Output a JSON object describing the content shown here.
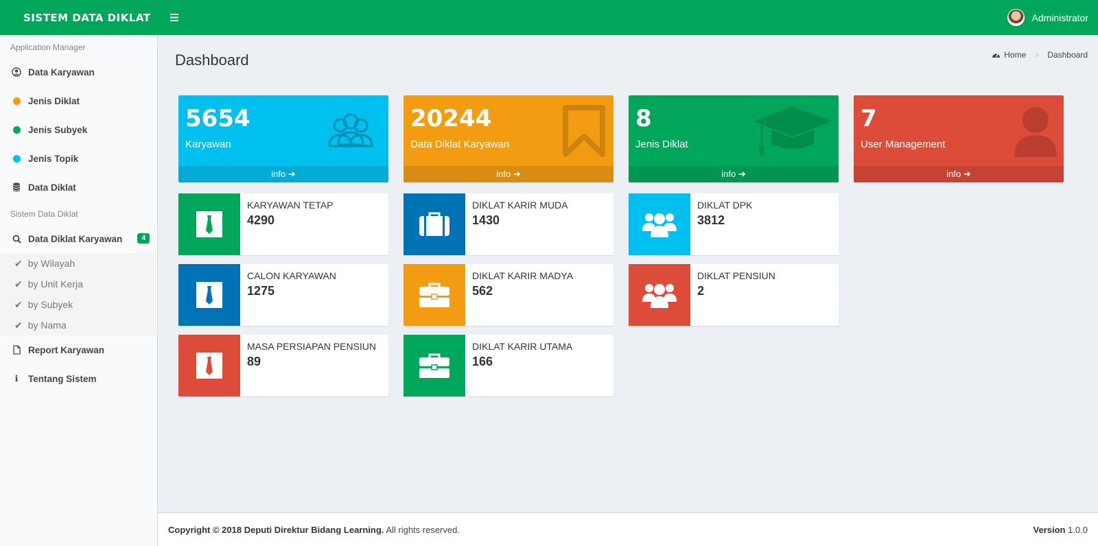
{
  "app": {
    "title": "SISTEM DATA DIKLAT",
    "user_name": "Administrator"
  },
  "sidebar": {
    "section1": "Application Manager",
    "items1": [
      {
        "label": "Data Karyawan",
        "icon": "user-circle-icon"
      },
      {
        "label": "Jenis Diklat",
        "icon": "dot-icon",
        "color": "#f39c12"
      },
      {
        "label": "Jenis Subyek",
        "icon": "dot-icon",
        "color": "#00a65a"
      },
      {
        "label": "Jenis Topik",
        "icon": "dot-icon",
        "color": "#00c0ef"
      },
      {
        "label": "Data Diklat",
        "icon": "database-icon"
      }
    ],
    "section2": "Sistem Data Diklat",
    "active": {
      "label": "Data Diklat Karyawan",
      "badge": "4",
      "icon": "search-icon"
    },
    "subitems": [
      "by Wilayah",
      "by Unit Kerja",
      "by Subyek",
      "by Nama"
    ],
    "items2": [
      {
        "label": "Report Karyawan",
        "icon": "file-icon"
      },
      {
        "label": "Tentang Sistem",
        "icon": "info-icon"
      }
    ]
  },
  "page": {
    "title": "Dashboard"
  },
  "breadcrumb": {
    "home": "Home",
    "current": "Dashboard"
  },
  "stat_boxes": [
    {
      "value": "5654",
      "label": "Karyawan",
      "footer": "info",
      "color": "#00c0ef",
      "icon": "users-icon"
    },
    {
      "value": "20244",
      "label": "Data Diklat Karyawan",
      "footer": "info",
      "color": "#f39c12",
      "icon": "bookmark-icon"
    },
    {
      "value": "8",
      "label": "Jenis Diklat",
      "footer": "info",
      "color": "#00a65a",
      "icon": "graduation-cap-icon"
    },
    {
      "value": "7",
      "label": "User Management",
      "footer": "info",
      "color": "#dd4b39",
      "icon": "user-icon"
    }
  ],
  "info_boxes": [
    {
      "title": "KARYAWAN TETAP",
      "value": "4290",
      "color": "#00a65a",
      "icon": "tie-icon",
      "accent": "#00a65a"
    },
    {
      "title": "CALON KARYAWAN",
      "value": "1275",
      "color": "#0073b7",
      "icon": "tie-icon",
      "accent": "#0073b7"
    },
    {
      "title": "MASA PERSIAPAN PENSIUN",
      "value": "89",
      "color": "#dd4b39",
      "icon": "tie-icon",
      "accent": "#dd4b39"
    },
    {
      "title": "DIKLAT KARIR MUDA",
      "value": "1430",
      "color": "#0073b7",
      "icon": "suitcase-icon"
    },
    {
      "title": "DIKLAT KARIR MADYA",
      "value": "562",
      "color": "#f39c12",
      "icon": "briefcase-icon"
    },
    {
      "title": "DIKLAT KARIR UTAMA",
      "value": "166",
      "color": "#00a65a",
      "icon": "briefcase-icon"
    },
    {
      "title": "DIKLAT DPK",
      "value": "3812",
      "color": "#00c0ef",
      "icon": "users-icon"
    },
    {
      "title": "DIKLAT PENSIUN",
      "value": "2",
      "color": "#dd4b39",
      "icon": "users-icon"
    }
  ],
  "footer": {
    "copyright": "Copyright © 2018 Deputi Direktur Bidang Learning.",
    "rights": "All rights reserved.",
    "version_label": "Version",
    "version": "1.0.0"
  }
}
